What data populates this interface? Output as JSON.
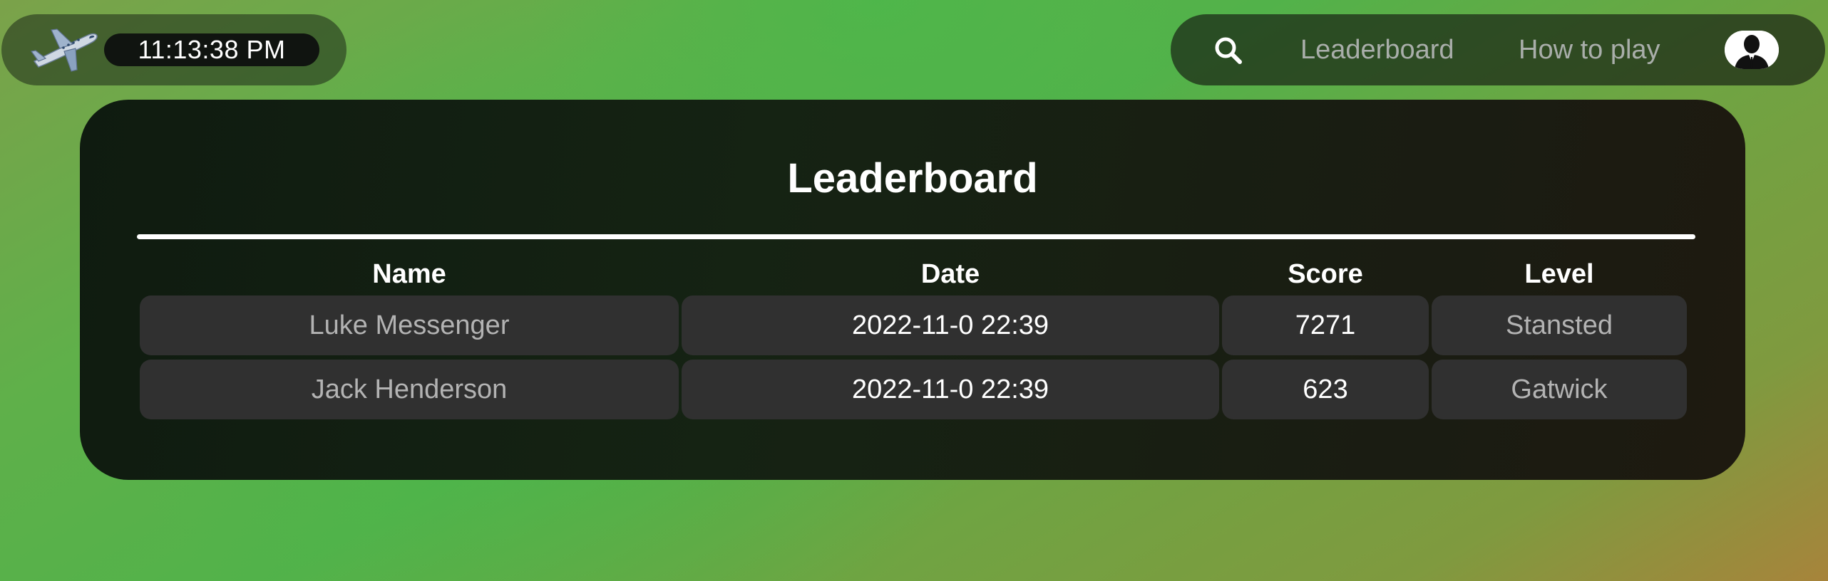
{
  "header": {
    "clock": "11:13:38 PM",
    "logo_icon": "airplane-icon"
  },
  "nav": {
    "search_icon": "search-icon",
    "leaderboard_label": "Leaderboard",
    "how_to_play_label": "How to play",
    "avatar_icon": "user-avatar-icon"
  },
  "leaderboard": {
    "title": "Leaderboard",
    "columns": [
      "Name",
      "Date",
      "Score",
      "Level"
    ],
    "rows": [
      {
        "name": "Luke Messenger",
        "date": "2022-11-0 22:39",
        "score": "7271",
        "level": "Stansted"
      },
      {
        "name": "Jack Henderson",
        "date": "2022-11-0 22:39",
        "score": "623",
        "level": "Gatwick"
      }
    ]
  }
}
